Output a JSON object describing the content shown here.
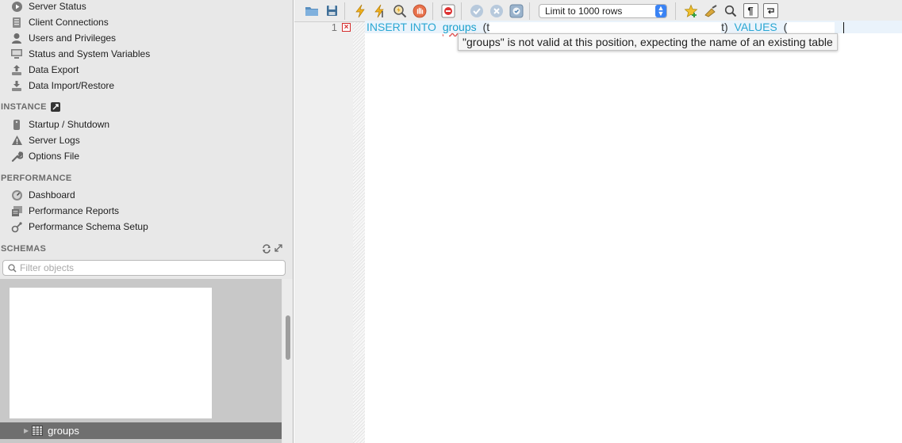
{
  "sidebar": {
    "management_items": [
      {
        "label": "Server Status",
        "icon": "play-circle-icon"
      },
      {
        "label": "Client Connections",
        "icon": "client-connections-icon"
      },
      {
        "label": "Users and Privileges",
        "icon": "user-icon"
      },
      {
        "label": "Status and System Variables",
        "icon": "monitor-icon"
      },
      {
        "label": "Data Export",
        "icon": "data-export-icon"
      },
      {
        "label": "Data Import/Restore",
        "icon": "data-import-icon"
      }
    ],
    "instance": {
      "header": "INSTANCE",
      "items": [
        {
          "label": "Startup / Shutdown",
          "icon": "server-icon"
        },
        {
          "label": "Server Logs",
          "icon": "warning-icon"
        },
        {
          "label": "Options File",
          "icon": "wrench-icon"
        }
      ]
    },
    "performance": {
      "header": "PERFORMANCE",
      "items": [
        {
          "label": "Dashboard",
          "icon": "dashboard-icon"
        },
        {
          "label": "Performance Reports",
          "icon": "reports-icon"
        },
        {
          "label": "Performance Schema Setup",
          "icon": "schema-setup-icon"
        }
      ]
    },
    "schemas": {
      "header": "SCHEMAS",
      "filter_placeholder": "Filter objects",
      "selected_table": "groups"
    }
  },
  "toolbar": {
    "limit_select_value": "Limit to 1000 rows"
  },
  "editor": {
    "line_number": "1",
    "tokens": {
      "insert_into": "INSERT INTO",
      "table": "groups",
      "open_paren": "(",
      "col_first_char": "t",
      "col_last_char": "t)",
      "values": "VALUES",
      "values_paren": "("
    },
    "error_tooltip": "\"groups\" is not valid at this position, expecting the name of an existing table"
  },
  "colors": {
    "keyword": "#29a7d3",
    "error": "#d42a2a",
    "selected_row": "#6f6f6f",
    "current_line": "#eaf3fb"
  }
}
